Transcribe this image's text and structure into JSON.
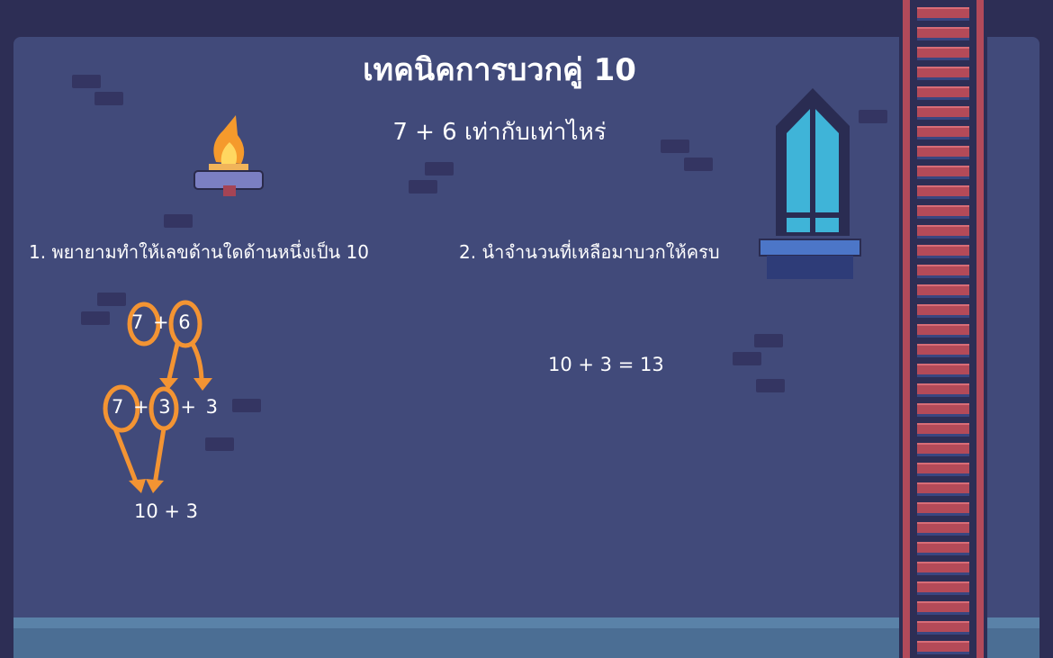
{
  "title": "เทคนิคการบวกคู่ 10",
  "question": "7 + 6 เท่ากับเท่าไหร่",
  "steps": [
    "1. พยายามทำให้เลขด้านใดด้านหนึ่งเป็น 10",
    "2. นำจำนวนที่เหลือมาบวกให้ครบ"
  ],
  "work": {
    "line1": "7 + 6",
    "line2": "7 + 3 + 3",
    "line3": "10 + 3",
    "answer": "10 + 3 = 13"
  },
  "colors": {
    "background": "#414a7a",
    "annotation": "#f39433",
    "floor": "#4b6e94"
  }
}
